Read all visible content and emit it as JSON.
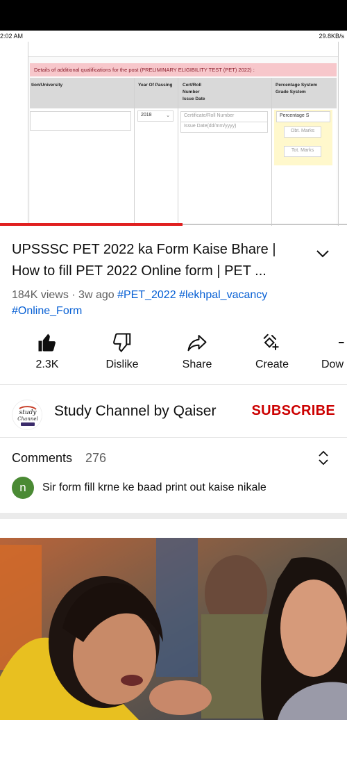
{
  "status_bar": {
    "time": "2:02 AM",
    "net_speed": "29.8KB/s"
  },
  "video_frame": {
    "section_heading": "Details of additional qualifications for the post (PRELIMINARY ELIGIBILITY TEST (PET) 2022) :",
    "columns": {
      "institution": "tion/University",
      "year": "Year Of Passing",
      "cert_line1": "Cert/Roll",
      "cert_line2": "Number",
      "cert_line3": "Issue Date",
      "pct_line1": "Percentage System",
      "pct_line2": "Grade System"
    },
    "year_value": "2018",
    "cert_placeholder": "Certificate/Roll Number",
    "date_placeholder": "Issue Date(dd/mm/yyyy)",
    "percentage_select": "Percentage S",
    "obt_marks_placeholder": "Obt. Marks",
    "tot_marks_placeholder": "Tot. Marks"
  },
  "progress": {
    "fraction": 0.526
  },
  "video": {
    "title": "UPSSSC PET 2022 ka Form Kaise Bhare | How to fill PET 2022 Online form | PET ...",
    "views": "184K views",
    "age": "3w ago",
    "separator": " · ",
    "tags": [
      "#PET_2022",
      "#lekhpal_vacancy",
      "#Online_Form"
    ]
  },
  "actions": [
    {
      "label": "2.3K",
      "icon": "thumbs-up-icon"
    },
    {
      "label": "Dislike",
      "icon": "thumbs-down-icon"
    },
    {
      "label": "Share",
      "icon": "share-icon"
    },
    {
      "label": "Create",
      "icon": "create-icon"
    },
    {
      "label": "Dow",
      "icon": "download-icon"
    }
  ],
  "channel": {
    "name": "Study Channel by Qaiser",
    "avatar_text": "study Channel",
    "subscribe_label": "SUBSCRIBE"
  },
  "comments": {
    "title": "Comments",
    "count": "276",
    "first": {
      "avatar_letter": "n",
      "text": "Sir form fill krne ke baad print out kaise nikale"
    }
  },
  "colors": {
    "accent_red": "#cc0000",
    "link_blue": "#065fd4",
    "progress_red": "#e02020"
  }
}
